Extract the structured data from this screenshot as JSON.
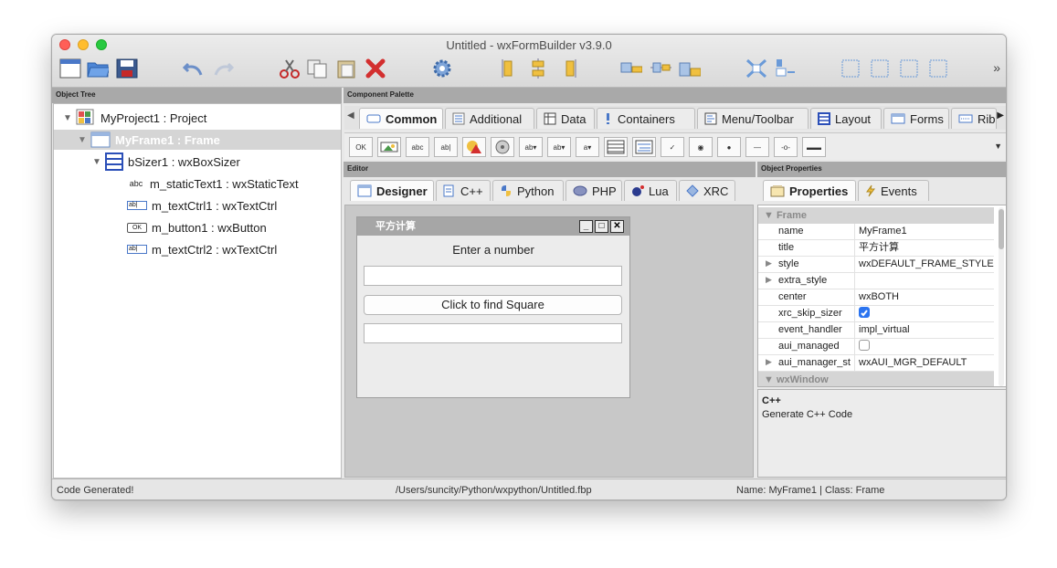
{
  "window": {
    "title": "Untitled - wxFormBuilder v3.9.0"
  },
  "toolbar": {
    "icons": [
      "new-project-icon",
      "open-project-icon",
      "save-project-icon",
      "undo-icon",
      "redo-icon",
      "cut-icon",
      "copy-icon",
      "paste-icon",
      "delete-icon",
      "generate-code-icon",
      "align-left-icon",
      "align-center-icon",
      "align-right-icon",
      "align-top-icon",
      "align-middle-icon",
      "align-bottom-icon",
      "expand-icon",
      "stretch-icon",
      "border-left-icon",
      "border-right-icon",
      "border-top-icon",
      "border-bottom-icon"
    ],
    "more": "»"
  },
  "object_tree": {
    "header": "Object Tree",
    "items": [
      {
        "label": "MyProject1 : Project",
        "icon": "project-icon"
      },
      {
        "label": "MyFrame1 : Frame",
        "icon": "frame-icon"
      },
      {
        "label": "bSizer1 : wxBoxSizer",
        "icon": "boxsizer-icon"
      },
      {
        "label": "m_staticText1 : wxStaticText",
        "icon": "static-text-icon",
        "icon_text": "abc"
      },
      {
        "label": "m_textCtrl1 : wxTextCtrl",
        "icon": "text-ctrl-icon",
        "icon_text": "ab|"
      },
      {
        "label": "m_button1 : wxButton",
        "icon": "button-icon",
        "icon_text": "OK"
      },
      {
        "label": "m_textCtrl2 : wxTextCtrl",
        "icon": "text-ctrl-icon",
        "icon_text": "ab|"
      }
    ]
  },
  "palette": {
    "header": "Component Palette",
    "tabs": [
      {
        "label": "Common",
        "active": true
      },
      {
        "label": "Additional"
      },
      {
        "label": "Data"
      },
      {
        "label": "Containers"
      },
      {
        "label": "Menu/Toolbar"
      },
      {
        "label": "Layout"
      },
      {
        "label": "Forms"
      },
      {
        "label": "Rib"
      }
    ],
    "items": [
      "OK",
      "img",
      "abc",
      "ab|",
      "bmp",
      "anim",
      "ab▾",
      "ab▾",
      "a▾",
      "list",
      "list2",
      "✓",
      "◉",
      "●",
      "—",
      "-o-",
      "▬▬"
    ]
  },
  "editor": {
    "header": "Editor",
    "tabs": [
      {
        "label": "Designer",
        "active": true
      },
      {
        "label": "C++"
      },
      {
        "label": "Python"
      },
      {
        "label": "PHP"
      },
      {
        "label": "Lua"
      },
      {
        "label": "XRC"
      }
    ],
    "preview": {
      "title": "平方计算",
      "min": "_",
      "max": "□",
      "close": "✕",
      "label": "Enter a number",
      "button": "Click to find Square"
    }
  },
  "properties": {
    "header": "Object Properties",
    "tabs": [
      {
        "label": "Properties",
        "active": true
      },
      {
        "label": "Events"
      }
    ],
    "category": "Frame",
    "rows": [
      {
        "name": "name",
        "value": "MyFrame1"
      },
      {
        "name": "title",
        "value": "平方计算"
      },
      {
        "name": "style",
        "value": "wxDEFAULT_FRAME_STYLE",
        "expandable": true
      },
      {
        "name": "extra_style",
        "value": "",
        "expandable": true
      },
      {
        "name": "center",
        "value": "wxBOTH"
      },
      {
        "name": "xrc_skip_sizer",
        "checked": true
      },
      {
        "name": "event_handler",
        "value": "impl_virtual"
      },
      {
        "name": "aui_managed",
        "checked": false
      },
      {
        "name": "aui_manager_st",
        "value": "wxAUI_MGR_DEFAULT",
        "expandable": true
      }
    ],
    "category2": "wxWindow",
    "description": {
      "title": "C++",
      "text": "Generate C++ Code"
    }
  },
  "status": {
    "left": "Code Generated!",
    "center": "/Users/suncity/Python/wxpython/Untitled.fbp",
    "right": "Name: MyFrame1 | Class: Frame"
  }
}
